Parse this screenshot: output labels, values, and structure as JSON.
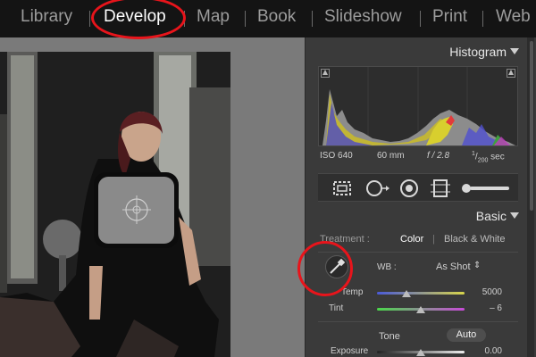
{
  "modules": {
    "items": [
      {
        "label": "Library",
        "active": false
      },
      {
        "label": "Develop",
        "active": true
      },
      {
        "label": "Map",
        "active": false
      },
      {
        "label": "Book",
        "active": false
      },
      {
        "label": "Slideshow",
        "active": false
      },
      {
        "label": "Print",
        "active": false
      },
      {
        "label": "Web",
        "active": false
      }
    ]
  },
  "histogram": {
    "title": "Histogram",
    "iso": "ISO 640",
    "focal_length": "60 mm",
    "aperture": "f / 2.8",
    "shutter_numerator": "1",
    "shutter_denominator": "200",
    "shutter_unit": "sec"
  },
  "tools": {
    "items": [
      "crop-overlay-icon",
      "spot-removal-icon",
      "red-eye-icon",
      "graduated-filter-icon",
      "adjustment-brush-icon"
    ]
  },
  "basic": {
    "title": "Basic",
    "treatment_label": "Treatment :",
    "treatment_color": "Color",
    "treatment_bw": "Black & White",
    "wb_label": "WB :",
    "wb_value": "As Shot",
    "temp_label": "Temp",
    "temp_value": "5000",
    "tint_label": "Tint",
    "tint_value": "– 6",
    "tone_label": "Tone",
    "auto_label": "Auto",
    "exposure_label": "Exposure",
    "exposure_value": "0.00"
  },
  "colors": {
    "annotation_ring": "#e8141b",
    "panel_bg": "#3a3a3a",
    "topbar_bg": "#141414",
    "canvas_bg": "#7a7a7a"
  }
}
